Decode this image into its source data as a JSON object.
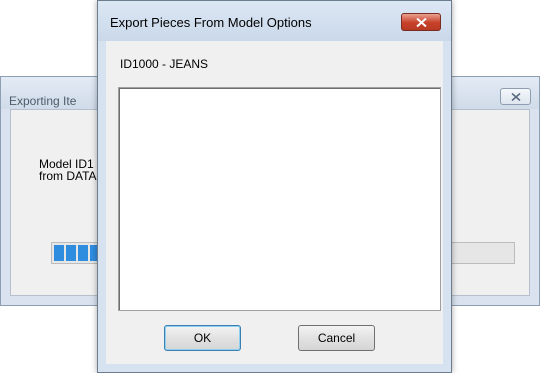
{
  "background_window": {
    "title": "Exporting Ite",
    "message_line1": "Model ID1",
    "message_line2": "from DATA",
    "progress_fraction": 0.12
  },
  "dialog": {
    "title": "Export Pieces From Model Options",
    "model_label": "ID1000 - JEANS",
    "list_items": [],
    "ok_label": "OK",
    "cancel_label": "Cancel"
  },
  "colors": {
    "progress_fill": "#2f8de0",
    "close_button_red": "#c7402a",
    "titlebar": "#d6e2f0"
  },
  "icons": {
    "bg_close": "close-icon",
    "dlg_close": "close-icon"
  }
}
